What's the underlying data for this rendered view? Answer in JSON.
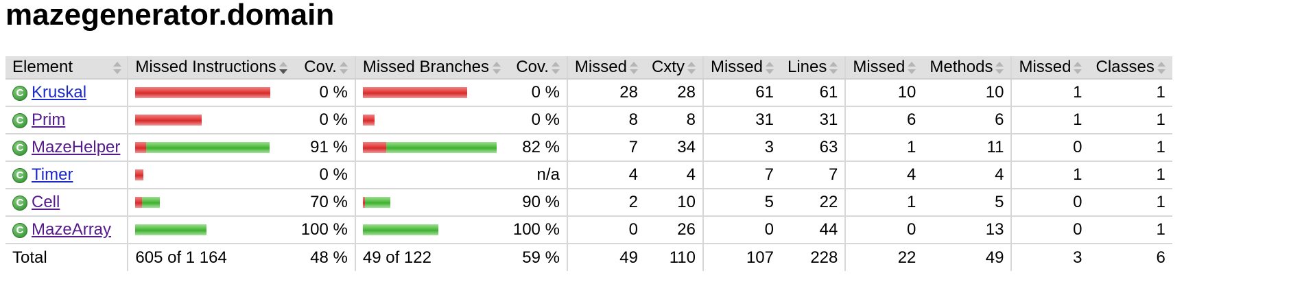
{
  "page_title": "mazegenerator.domain",
  "headers": {
    "element": "Element",
    "missed_instructions": "Missed Instructions",
    "cov1": "Cov.",
    "missed_branches": "Missed Branches",
    "cov2": "Cov.",
    "missed_cxty": "Missed",
    "cxty": "Cxty",
    "missed_lines": "Missed",
    "lines": "Lines",
    "missed_methods": "Missed",
    "methods": "Methods",
    "missed_classes": "Missed",
    "classes": "Classes"
  },
  "colors": {
    "missed": "#e23b3b",
    "covered": "#4fbb3f",
    "header_bg": "#e0e0e0",
    "link": "#1a29c8",
    "visited_link": "#551a8b"
  },
  "rows": [
    {
      "name": "Kruskal",
      "instr_missed": 0.1701,
      "instr_covered": 0.0,
      "instr_cov": "0 %",
      "branch_missed": 0.1311,
      "branch_covered": 0.0,
      "branch_cov": "0 %",
      "missed_cxty": "28",
      "cxty": "28",
      "missed_lines": "61",
      "lines": "61",
      "missed_methods": "10",
      "methods": "10",
      "missed_classes": "1",
      "classes": "1",
      "visited": false
    },
    {
      "name": "Prim",
      "instr_missed": 0.084,
      "instr_covered": 0.0,
      "instr_cov": "0 %",
      "branch_missed": 0.0148,
      "branch_covered": 0.0,
      "branch_cov": "0 %",
      "missed_cxty": "8",
      "cxty": "8",
      "missed_lines": "31",
      "lines": "31",
      "missed_methods": "6",
      "methods": "6",
      "missed_classes": "1",
      "classes": "1",
      "visited": true
    },
    {
      "name": "MazeHelper",
      "instr_missed": 0.0137,
      "instr_covered": 0.1556,
      "instr_cov": "91 %",
      "branch_missed": 0.0291,
      "branch_covered": 0.1389,
      "branch_cov": "82 %",
      "missed_cxty": "7",
      "cxty": "34",
      "missed_lines": "3",
      "lines": "63",
      "missed_methods": "1",
      "methods": "11",
      "missed_classes": "0",
      "classes": "1",
      "visited": true
    },
    {
      "name": "Timer",
      "instr_missed": 0.0103,
      "instr_covered": 0.0,
      "instr_cov": "0 %",
      "branch_missed": 0.0,
      "branch_covered": 0.0,
      "branch_cov": "n/a",
      "missed_cxty": "4",
      "cxty": "4",
      "missed_lines": "7",
      "lines": "7",
      "missed_methods": "4",
      "methods": "4",
      "missed_classes": "1",
      "classes": "1",
      "visited": false
    },
    {
      "name": "Cell",
      "instr_missed": 0.0085,
      "instr_covered": 0.0223,
      "instr_cov": "70 %",
      "branch_missed": 0.0029,
      "branch_covered": 0.0319,
      "branch_cov": "90 %",
      "missed_cxty": "2",
      "cxty": "10",
      "missed_lines": "5",
      "lines": "22",
      "missed_methods": "1",
      "methods": "5",
      "missed_classes": "0",
      "classes": "1",
      "visited": true
    },
    {
      "name": "MazeArray",
      "instr_missed": 0.0,
      "instr_covered": 0.0893,
      "instr_cov": "100 %",
      "branch_missed": 0.0,
      "branch_covered": 0.0946,
      "branch_cov": "100 %",
      "missed_cxty": "0",
      "cxty": "26",
      "missed_lines": "0",
      "lines": "44",
      "missed_methods": "0",
      "methods": "13",
      "missed_classes": "0",
      "classes": "1",
      "visited": true
    }
  ],
  "total": {
    "label": "Total",
    "instructions": "605 of 1 164",
    "instr_cov": "48 %",
    "branches": "49 of 122",
    "branch_cov": "59 %",
    "missed_cxty": "49",
    "cxty": "110",
    "missed_lines": "107",
    "lines": "228",
    "missed_methods": "22",
    "methods": "49",
    "missed_classes": "3",
    "classes": "6"
  }
}
